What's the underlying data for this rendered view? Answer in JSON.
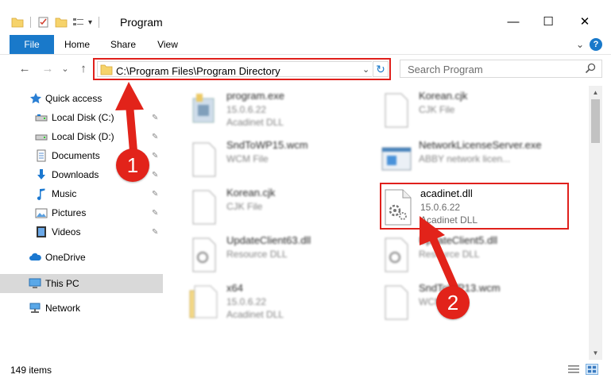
{
  "window": {
    "title": "Program",
    "minimize_glyph": "—",
    "maximize_glyph": "☐",
    "close_glyph": "✕"
  },
  "quick_access_toolbar": {
    "customize_glyph": "▾"
  },
  "ribbon": {
    "tabs": [
      {
        "label": "File"
      },
      {
        "label": "Home"
      },
      {
        "label": "Share"
      },
      {
        "label": "View"
      }
    ],
    "expand_glyph": "⌄",
    "help_glyph": "?"
  },
  "navigation": {
    "back_glyph": "←",
    "forward_glyph": "→",
    "recent_glyph": "⌄",
    "up_glyph": "↑"
  },
  "address": {
    "path": "C:\\Program Files\\Program Directory",
    "dropdown_glyph": "⌄",
    "refresh_glyph": "↻"
  },
  "search": {
    "placeholder": "Search Program"
  },
  "nav_pane": {
    "items": [
      {
        "label": "Quick access",
        "icon": "star-icon"
      },
      {
        "label": "Local Disk (C:)",
        "icon": "drive-icon",
        "pinned": true
      },
      {
        "label": "Local Disk (D:)",
        "icon": "drive-icon",
        "pinned": true
      },
      {
        "label": "Documents",
        "icon": "documents-icon",
        "pinned": true
      },
      {
        "label": "Downloads",
        "icon": "downloads-icon",
        "pinned": true
      },
      {
        "label": "Music",
        "icon": "music-icon",
        "pinned": true
      },
      {
        "label": "Pictures",
        "icon": "pictures-icon",
        "pinned": true
      },
      {
        "label": "Videos",
        "icon": "videos-icon",
        "pinned": true
      },
      {
        "label": "OneDrive",
        "icon": "cloud-icon"
      },
      {
        "label": "This PC",
        "icon": "computer-icon",
        "selected": true
      },
      {
        "label": "Network",
        "icon": "network-icon"
      }
    ],
    "pin_glyph": "📌"
  },
  "files": [
    {
      "name": "program.exe",
      "line2": "15.0.6.22",
      "line3": "Acadinet DLL",
      "icon": "exe-icon",
      "blurred": true
    },
    {
      "name": "Korean.cjk",
      "line2": "CJK File",
      "line3": "",
      "icon": "blank-file-icon",
      "blurred": true
    },
    {
      "name": "SndToWP15.wcm",
      "line2": "WCM File",
      "line3": "",
      "icon": "blank-file-icon",
      "blurred": true
    },
    {
      "name": "NetworkLicenseServer.exe",
      "line2": "ABBY network licen...",
      "line3": "",
      "icon": "window-app-icon",
      "blurred": true
    },
    {
      "name": "Korean.cjk",
      "line2": "CJK File",
      "line3": "",
      "icon": "blank-file-icon",
      "blurred": true
    },
    {
      "name": "acadinet.dll",
      "line2": "15.0.6.22",
      "line3": "Acadinet DLL",
      "icon": "dll-gear-icon",
      "blurred": false
    },
    {
      "name": "UpdateClient63.dll",
      "line2": "Resource DLL",
      "line3": "",
      "icon": "dll-gear-icon",
      "blurred": true
    },
    {
      "name": "UpdateClient5.dll",
      "line2": "Resource DLL",
      "line3": "",
      "icon": "dll-gear-icon",
      "blurred": true
    },
    {
      "name": "x64",
      "line2": "15.0.6.22",
      "line3": "Acadinet DLL",
      "icon": "folder-file-icon",
      "blurred": true
    },
    {
      "name": "SndToWP13.wcm",
      "line2": "WCM File",
      "line3": "",
      "icon": "blank-file-icon",
      "blurred": true
    }
  ],
  "status": {
    "item_count": "149 items"
  },
  "annotations": {
    "marker1": "1",
    "marker2": "2",
    "color": "#e2231a"
  },
  "colors": {
    "accent": "#1979ca",
    "highlight_border": "#e0201c"
  }
}
